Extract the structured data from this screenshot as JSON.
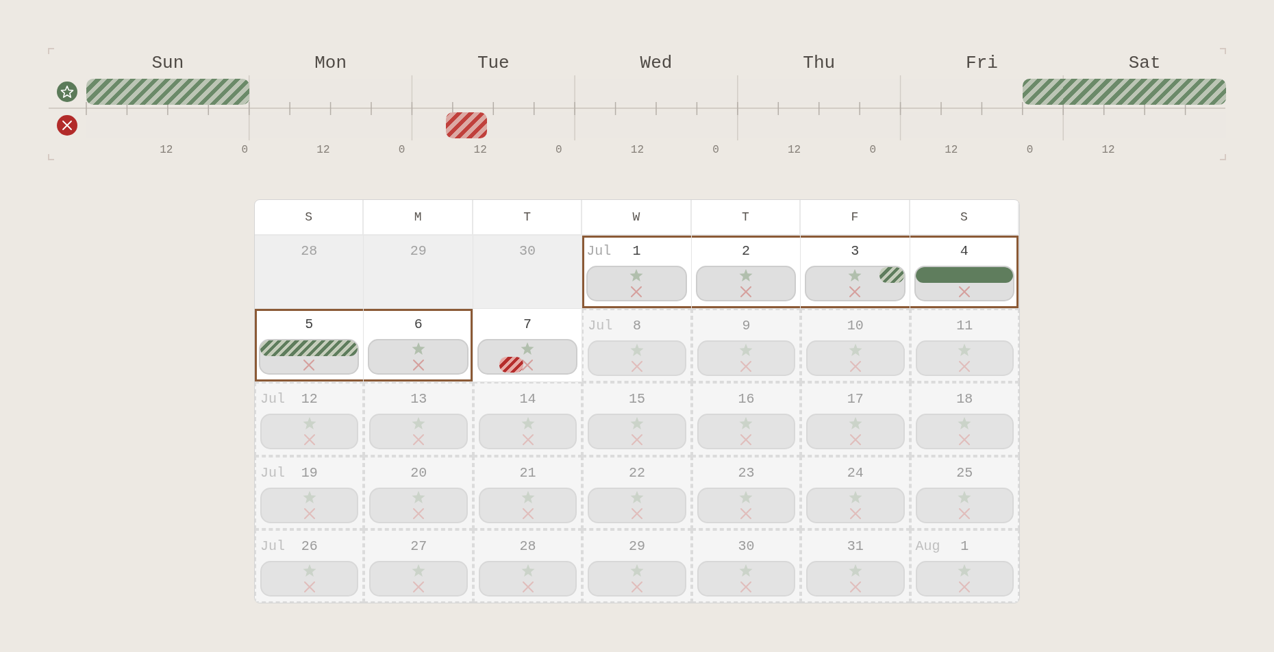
{
  "timeline": {
    "days": [
      {
        "label": "Sun",
        "top_lane": [
          {
            "kind": "striped",
            "level": 1
          }
        ]
      },
      {
        "label": "Mon"
      },
      {
        "label": "Tue",
        "bottom_lane": [
          {
            "kind": "gap",
            "level": 0.21
          },
          {
            "kind": "striped",
            "level": 0.25
          }
        ]
      },
      {
        "label": "Wed"
      },
      {
        "label": "Thu"
      },
      {
        "label": "Fri",
        "top_lane": [
          {
            "kind": "gap",
            "level": 0.75
          },
          {
            "kind": "striped",
            "level": 0.25
          }
        ]
      },
      {
        "label": "Sat",
        "top_lane": [
          {
            "kind": "striped",
            "level": 1
          }
        ]
      }
    ],
    "tick_labels": [
      "12",
      "0",
      "12",
      "0",
      "12",
      "0",
      "12",
      "0",
      "12",
      "0",
      "12",
      "0",
      "12"
    ]
  },
  "calendar": {
    "weekdays": [
      "S",
      "M",
      "T",
      "W",
      "T",
      "F",
      "S"
    ],
    "weeks": [
      [
        {
          "date": "28",
          "outside_month": true,
          "disabled": false,
          "selected": false
        },
        {
          "date": "29",
          "outside_month": true,
          "disabled": false,
          "selected": false
        },
        {
          "date": "30",
          "outside_month": true,
          "disabled": false,
          "selected": false
        },
        {
          "month": "Jul",
          "date": "1",
          "outside_month": false,
          "disabled": false,
          "selected": true
        },
        {
          "date": "2",
          "outside_month": false,
          "disabled": false,
          "selected": true
        },
        {
          "date": "3",
          "outside_month": false,
          "disabled": false,
          "selected": true,
          "top_lane": [
            {
              "kind": "gap",
              "level": 0.75
            },
            {
              "kind": "striped",
              "level": 0.25
            }
          ]
        },
        {
          "date": "4",
          "outside_month": false,
          "disabled": false,
          "selected": true,
          "top_lane": [
            {
              "kind": "solid",
              "level": 1
            }
          ]
        }
      ],
      [
        {
          "date": "5",
          "outside_month": false,
          "disabled": false,
          "selected": true,
          "top_lane": [
            {
              "kind": "striped",
              "level": 1
            }
          ]
        },
        {
          "date": "6",
          "outside_month": false,
          "disabled": false,
          "selected": true
        },
        {
          "date": "7",
          "outside_month": false,
          "disabled": false,
          "selected": false,
          "bottom_lane": [
            {
              "kind": "gap",
              "level": 0.21
            },
            {
              "kind": "striped",
              "level": 0.25
            }
          ]
        },
        {
          "month": "Jul",
          "date": "8",
          "outside_month": false,
          "disabled": true,
          "selected": false
        },
        {
          "date": "9",
          "outside_month": false,
          "disabled": true,
          "selected": false
        },
        {
          "date": "10",
          "outside_month": false,
          "disabled": true,
          "selected": false
        },
        {
          "date": "11",
          "outside_month": false,
          "disabled": true,
          "selected": false
        }
      ],
      [
        {
          "month": "Jul",
          "date": "12",
          "outside_month": false,
          "disabled": true,
          "selected": false
        },
        {
          "date": "13",
          "outside_month": false,
          "disabled": true,
          "selected": false
        },
        {
          "date": "14",
          "outside_month": false,
          "disabled": true,
          "selected": false
        },
        {
          "date": "15",
          "outside_month": false,
          "disabled": true,
          "selected": false
        },
        {
          "date": "16",
          "outside_month": false,
          "disabled": true,
          "selected": false
        },
        {
          "date": "17",
          "outside_month": false,
          "disabled": true,
          "selected": false
        },
        {
          "date": "18",
          "outside_month": false,
          "disabled": true,
          "selected": false
        }
      ],
      [
        {
          "month": "Jul",
          "date": "19",
          "outside_month": false,
          "disabled": true,
          "selected": false
        },
        {
          "date": "20",
          "outside_month": false,
          "disabled": true,
          "selected": false
        },
        {
          "date": "21",
          "outside_month": false,
          "disabled": true,
          "selected": false
        },
        {
          "date": "22",
          "outside_month": false,
          "disabled": true,
          "selected": false
        },
        {
          "date": "23",
          "outside_month": false,
          "disabled": true,
          "selected": false
        },
        {
          "date": "24",
          "outside_month": false,
          "disabled": true,
          "selected": false
        },
        {
          "date": "25",
          "outside_month": false,
          "disabled": true,
          "selected": false
        }
      ],
      [
        {
          "month": "Jul",
          "date": "26",
          "outside_month": false,
          "disabled": true,
          "selected": false
        },
        {
          "date": "27",
          "outside_month": false,
          "disabled": true,
          "selected": false
        },
        {
          "date": "28",
          "outside_month": false,
          "disabled": true,
          "selected": false
        },
        {
          "date": "29",
          "outside_month": false,
          "disabled": true,
          "selected": false
        },
        {
          "date": "30",
          "outside_month": false,
          "disabled": true,
          "selected": false
        },
        {
          "date": "31",
          "outside_month": false,
          "disabled": true,
          "selected": false
        },
        {
          "month": "Aug",
          "date": "1",
          "outside_month": false,
          "disabled": true,
          "selected": false
        }
      ]
    ]
  }
}
